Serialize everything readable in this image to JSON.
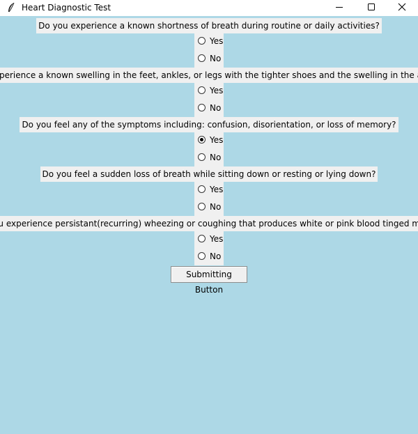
{
  "window": {
    "title": "Heart Diagnostic Test",
    "app_icon": "feather-icon",
    "controls": [
      "minimize-icon",
      "maximize-icon",
      "close-icon"
    ]
  },
  "colors": {
    "background": "#add8e6",
    "widget": "#f0f0f0"
  },
  "questions": [
    {
      "text": "Do you experience a known shortness of breath during routine or daily activities?",
      "options": [
        {
          "label": "Yes",
          "selected": false
        },
        {
          "label": "No",
          "selected": false
        }
      ]
    },
    {
      "text": "Do you experience a known swelling in the feet, ankles, or legs with the tighter shoes and the swelling in the abdomen?",
      "options": [
        {
          "label": "Yes",
          "selected": false
        },
        {
          "label": "No",
          "selected": false
        }
      ]
    },
    {
      "text": "Do you feel any of the symptoms including: confusion, disorientation, or loss of memory?",
      "options": [
        {
          "label": "Yes",
          "selected": true
        },
        {
          "label": "No",
          "selected": false
        }
      ]
    },
    {
      "text": "Do you feel a sudden loss of breath while sitting down or resting or lying down?",
      "options": [
        {
          "label": "Yes",
          "selected": false
        },
        {
          "label": "No",
          "selected": false
        }
      ]
    },
    {
      "text": "Do you experience persistant(recurring) wheezing or coughing that produces white or pink blood tinged mucus?",
      "options": [
        {
          "label": "Yes",
          "selected": false
        },
        {
          "label": "No",
          "selected": false
        }
      ]
    }
  ],
  "submit_label": "Submitting Button"
}
